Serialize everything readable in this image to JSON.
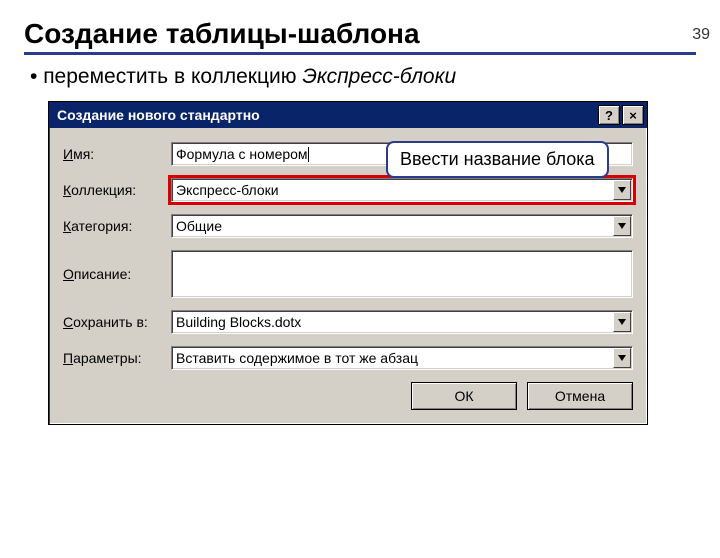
{
  "slide": {
    "number": "39",
    "title": "Создание таблицы-шаблона"
  },
  "bullet": {
    "text": "переместить в коллекцию ",
    "italic": "Экспресс-блоки"
  },
  "callout": {
    "text": "Ввести название блока"
  },
  "dialog": {
    "title": "Создание нового стандартно",
    "help": "?",
    "close": "×",
    "labels": {
      "name": "Имя:",
      "collection": "Коллекция:",
      "category": "Категория:",
      "description": "Описание:",
      "savein": "Сохранить в:",
      "params": "Параметры:"
    },
    "values": {
      "name": "Формула с номером",
      "collection": "Экспресс-блоки",
      "category": "Общие",
      "description": "",
      "savein": "Building Blocks.dotx",
      "params": "Вставить содержимое в тот же абзац"
    },
    "buttons": {
      "ok": "ОК",
      "cancel": "Отмена"
    }
  }
}
